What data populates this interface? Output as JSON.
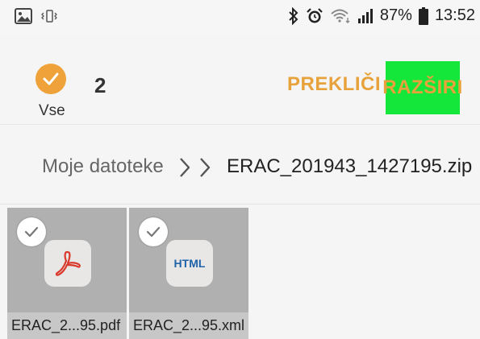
{
  "status_bar": {
    "battery": "87%",
    "time": "13:52",
    "icons": [
      "image-icon",
      "vibrate-icon",
      "bluetooth-icon",
      "alarm-icon",
      "wifi-icon",
      "signal-icon",
      "battery-icon"
    ]
  },
  "selection": {
    "all_label": "Vse",
    "count": "2",
    "cancel_label": "PREKLIČI",
    "extract_label": "RAZŠIRI"
  },
  "breadcrumb": {
    "root": "Moje datoteke",
    "current": "ERAC_201943_1427195.zip"
  },
  "files": [
    {
      "name": "ERAC_2...95.pdf",
      "icon": "pdf-icon",
      "selected": true
    },
    {
      "name": "ERAC_2...95.xml",
      "icon": "html-icon",
      "icon_text": "HTML",
      "selected": true
    }
  ],
  "colors": {
    "accent": "#e8a23c",
    "check_fill": "#f0a23a",
    "extract_highlight": "#15e63a",
    "tile_bg": "#b0b0b0",
    "pdf_red": "#d8392b"
  }
}
